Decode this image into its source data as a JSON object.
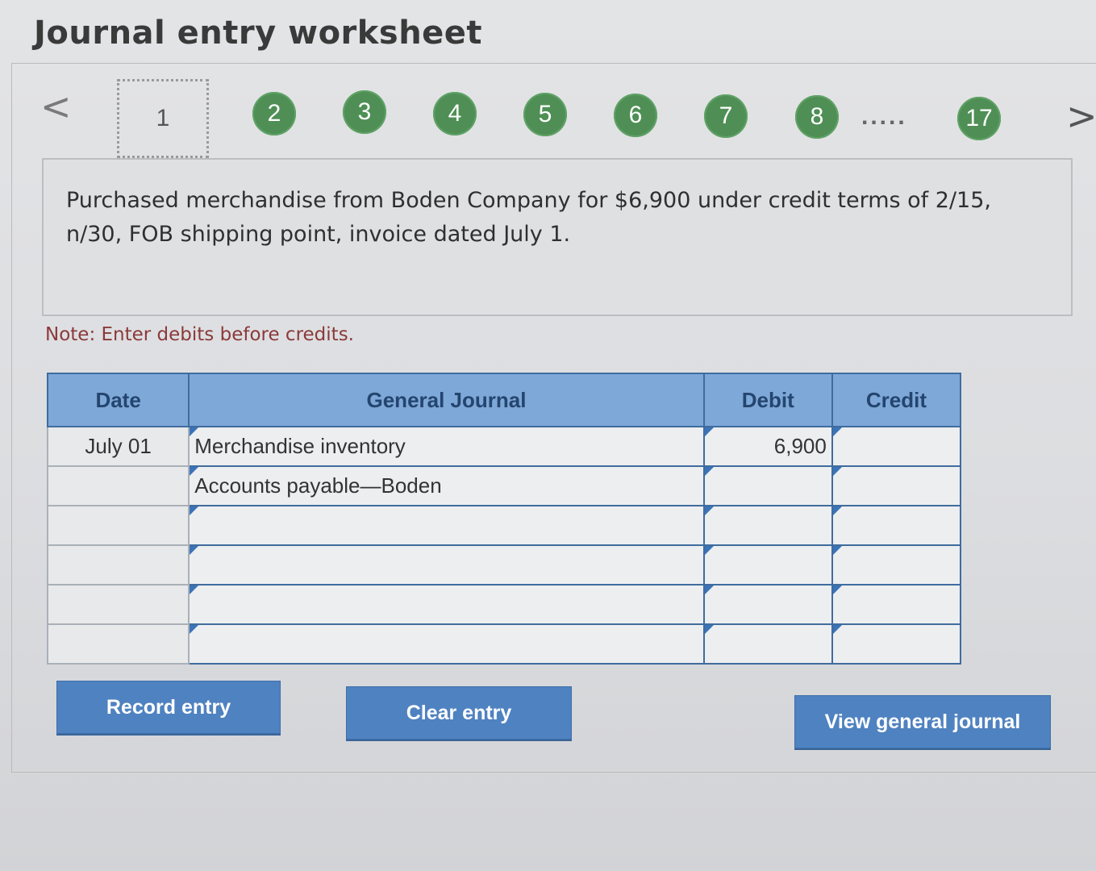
{
  "title": "Journal entry worksheet",
  "nav": {
    "current_step": "1",
    "steps": [
      "2",
      "3",
      "4",
      "5",
      "6",
      "7",
      "8"
    ],
    "ellipsis": ".....",
    "last_step": "17",
    "prev_arrow": "<",
    "next_arrow": ">"
  },
  "question": "Purchased merchandise from Boden Company for $6,900 under credit terms of 2/15, n/30, FOB shipping point, invoice dated July 1.",
  "note": "Note: Enter debits before credits.",
  "table": {
    "headers": {
      "date": "Date",
      "general_journal": "General Journal",
      "debit": "Debit",
      "credit": "Credit"
    },
    "rows": [
      {
        "date": "July 01",
        "account": "Merchandise inventory",
        "debit": "6,900",
        "credit": ""
      },
      {
        "date": "",
        "account": "Accounts payable—Boden",
        "debit": "",
        "credit": ""
      },
      {
        "date": "",
        "account": "",
        "debit": "",
        "credit": ""
      },
      {
        "date": "",
        "account": "",
        "debit": "",
        "credit": ""
      },
      {
        "date": "",
        "account": "",
        "debit": "",
        "credit": ""
      },
      {
        "date": "",
        "account": "",
        "debit": "",
        "credit": ""
      }
    ]
  },
  "buttons": {
    "record": "Record entry",
    "clear": "Clear entry",
    "view_journal": "View general journal"
  },
  "colors": {
    "step_green": "#4f8f55",
    "header_blue": "#7ea8d8",
    "button_blue": "#4f82c0",
    "note_red": "#8a3a3a"
  }
}
